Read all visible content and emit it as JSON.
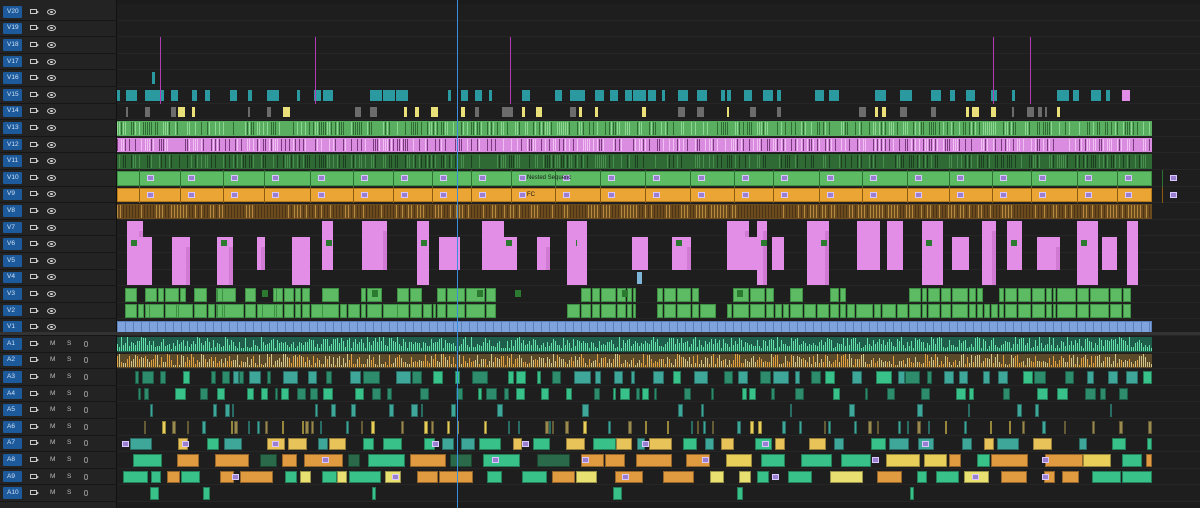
{
  "video_tracks": [
    "V20",
    "V19",
    "V18",
    "V17",
    "V16",
    "V15",
    "V14",
    "V13",
    "V12",
    "V11",
    "V10",
    "V9",
    "V8",
    "V7",
    "V6",
    "V5",
    "V4",
    "V3",
    "V2",
    "V1"
  ],
  "audio_tracks": [
    "A1",
    "A2",
    "A3",
    "A4",
    "A5",
    "A6",
    "A7",
    "A8",
    "A9",
    "A10"
  ],
  "audio_controls": {
    "mute": "M",
    "solo": "S"
  },
  "clip_labels": {
    "nested": "Nested Sequenc",
    "fc": "FC",
    "fx": "fx"
  },
  "icons": {
    "sync_lock": "film-strip-icon",
    "toggle_output": "eye-icon",
    "voiceover": "microphone-icon"
  },
  "colors": {
    "track_target": "#1d5a9c",
    "green_clip": "#5dbb63",
    "pink_clip": "#e28ee6",
    "orange_clip": "#eba535",
    "teal_clip": "#2a9aa0",
    "blue_clip": "#7fa3dc",
    "audio_green": "#38c28a",
    "playhead": "#3b8ede"
  }
}
